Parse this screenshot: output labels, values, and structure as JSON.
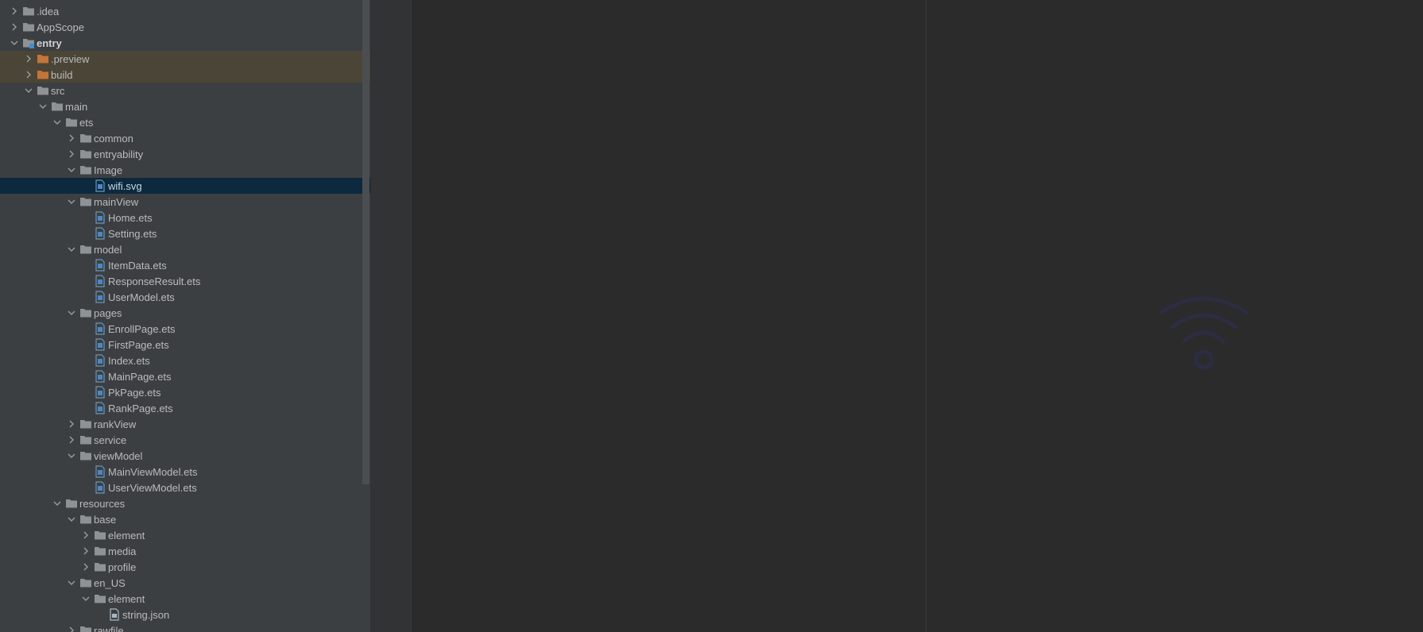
{
  "project_tree": {
    "items": [
      {
        "label": ".idea",
        "kind": "folder",
        "state": "collapsed"
      },
      {
        "label": "AppScope",
        "kind": "folder",
        "state": "collapsed"
      },
      {
        "label": "entry",
        "kind": "module",
        "state": "expanded",
        "bold": true
      },
      {
        "label": ".preview",
        "kind": "excluded-folder",
        "state": "collapsed"
      },
      {
        "label": "build",
        "kind": "excluded-folder",
        "state": "collapsed"
      },
      {
        "label": "src",
        "kind": "folder",
        "state": "expanded"
      },
      {
        "label": "main",
        "kind": "folder",
        "state": "expanded"
      },
      {
        "label": "ets",
        "kind": "folder",
        "state": "expanded"
      },
      {
        "label": "common",
        "kind": "folder",
        "state": "collapsed"
      },
      {
        "label": "entryability",
        "kind": "folder",
        "state": "collapsed"
      },
      {
        "label": "Image",
        "kind": "folder",
        "state": "expanded"
      },
      {
        "label": "wifi.svg",
        "kind": "file",
        "state": "leaf",
        "selected": true
      },
      {
        "label": "mainView",
        "kind": "folder",
        "state": "expanded"
      },
      {
        "label": "Home.ets",
        "kind": "file",
        "state": "leaf"
      },
      {
        "label": "Setting.ets",
        "kind": "file",
        "state": "leaf"
      },
      {
        "label": "model",
        "kind": "folder",
        "state": "expanded"
      },
      {
        "label": "ItemData.ets",
        "kind": "file",
        "state": "leaf"
      },
      {
        "label": "ResponseResult.ets",
        "kind": "file",
        "state": "leaf"
      },
      {
        "label": "UserModel.ets",
        "kind": "file",
        "state": "leaf"
      },
      {
        "label": "pages",
        "kind": "folder",
        "state": "expanded"
      },
      {
        "label": "EnrollPage.ets",
        "kind": "file",
        "state": "leaf"
      },
      {
        "label": "FirstPage.ets",
        "kind": "file",
        "state": "leaf"
      },
      {
        "label": "Index.ets",
        "kind": "file",
        "state": "leaf"
      },
      {
        "label": "MainPage.ets",
        "kind": "file",
        "state": "leaf"
      },
      {
        "label": "PkPage.ets",
        "kind": "file",
        "state": "leaf"
      },
      {
        "label": "RankPage.ets",
        "kind": "file",
        "state": "leaf"
      },
      {
        "label": "rankView",
        "kind": "folder",
        "state": "collapsed"
      },
      {
        "label": "service",
        "kind": "folder",
        "state": "collapsed"
      },
      {
        "label": "viewModel",
        "kind": "folder",
        "state": "expanded"
      },
      {
        "label": "MainViewModel.ets",
        "kind": "file",
        "state": "leaf"
      },
      {
        "label": "UserViewModel.ets",
        "kind": "file",
        "state": "leaf"
      },
      {
        "label": "resources",
        "kind": "folder",
        "state": "expanded"
      },
      {
        "label": "base",
        "kind": "folder",
        "state": "expanded"
      },
      {
        "label": "element",
        "kind": "folder",
        "state": "collapsed"
      },
      {
        "label": "media",
        "kind": "folder",
        "state": "collapsed"
      },
      {
        "label": "profile",
        "kind": "folder",
        "state": "collapsed"
      },
      {
        "label": "en_US",
        "kind": "folder",
        "state": "expanded"
      },
      {
        "label": "element",
        "kind": "folder",
        "state": "expanded"
      },
      {
        "label": "string.json",
        "kind": "json-file",
        "state": "leaf"
      },
      {
        "label": "rawfile",
        "kind": "folder",
        "state": "collapsed"
      }
    ]
  },
  "preview": {
    "icon": "wifi-icon",
    "color": "#2c2c42"
  },
  "colors": {
    "panel_bg": "#3c3f41",
    "editor_bg": "#2b2b2b",
    "selected_row": "#0d293e",
    "excluded_row": "#4a4536",
    "folder": "#8e9295",
    "excluded_folder": "#c5743a"
  }
}
